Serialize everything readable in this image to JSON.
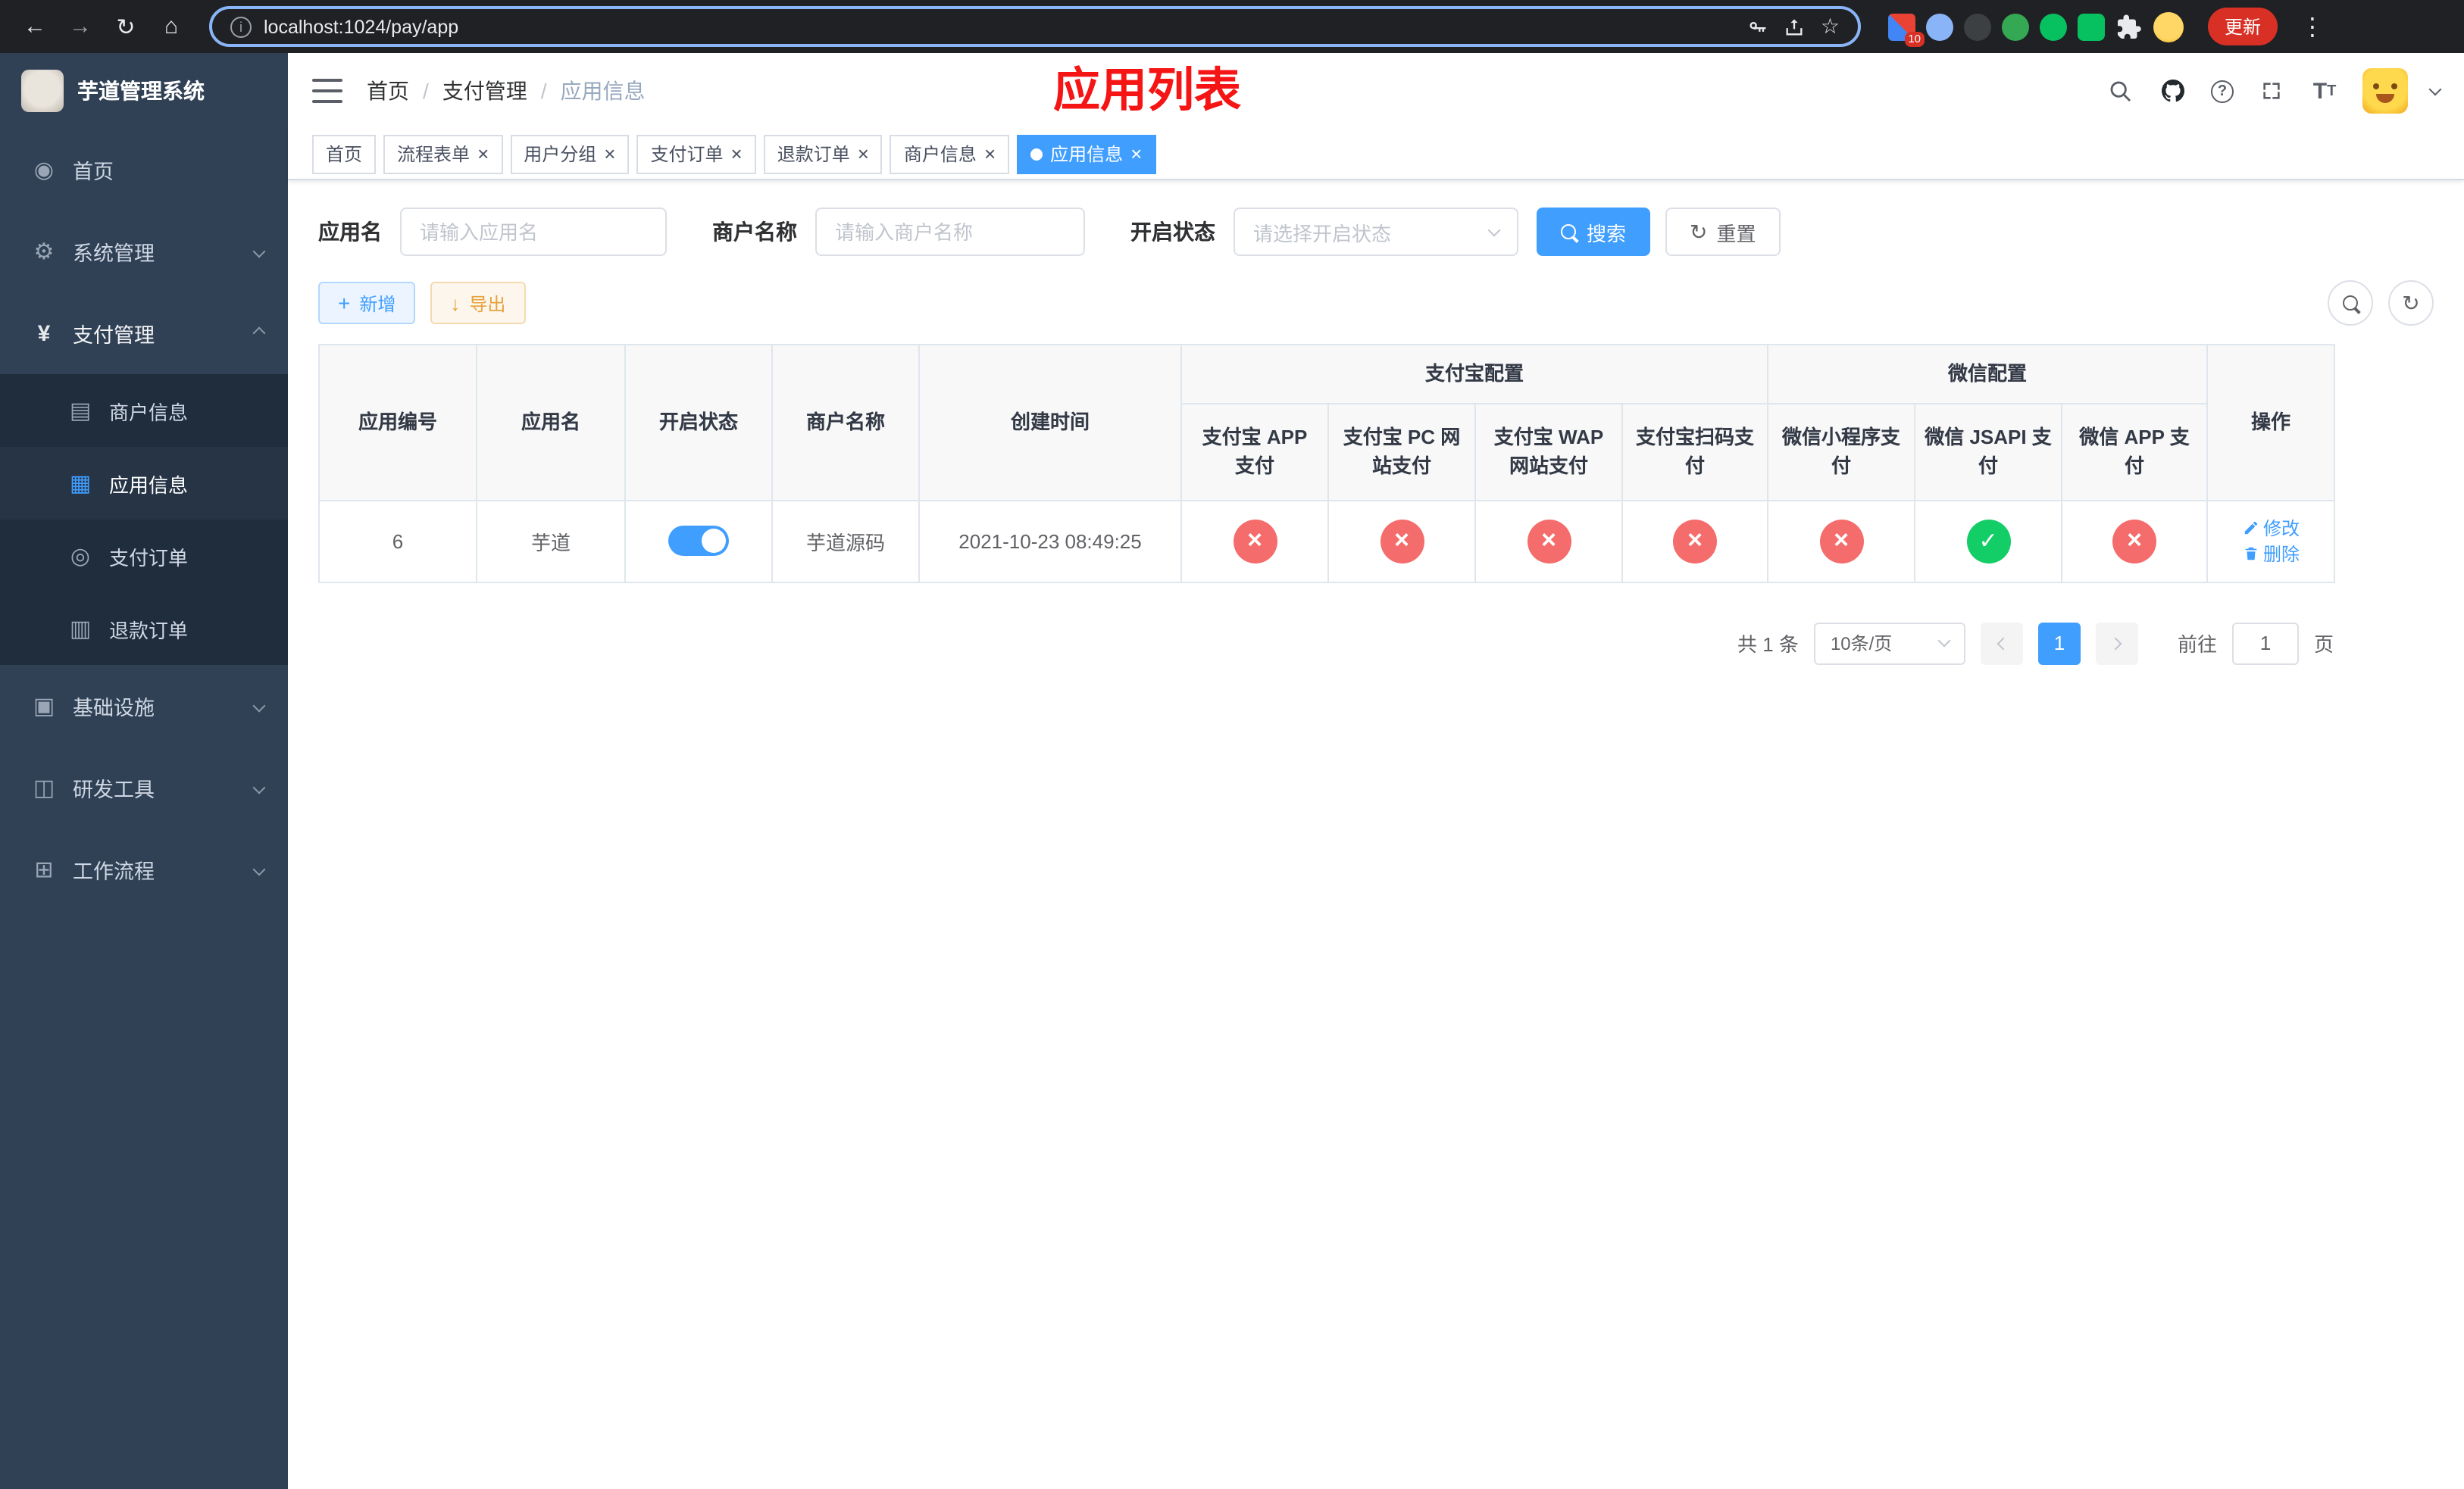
{
  "browser": {
    "url": "localhost:1024/pay/app",
    "update_label": "更新",
    "extension_badge": "10"
  },
  "sidebar": {
    "title": "芋道管理系统",
    "menu": [
      "首页",
      "系统管理",
      "支付管理",
      "商户信息",
      "应用信息",
      "支付订单",
      "退款订单",
      "基础设施",
      "研发工具",
      "工作流程"
    ]
  },
  "header": {
    "breadcrumb": [
      "首页",
      "支付管理",
      "应用信息"
    ],
    "annotation": "应用列表"
  },
  "tabs": [
    "首页",
    "流程表单",
    "用户分组",
    "支付订单",
    "退款订单",
    "商户信息",
    "应用信息"
  ],
  "filters": {
    "app_name_label": "应用名",
    "app_name_placeholder": "请输入应用名",
    "merchant_label": "商户名称",
    "merchant_placeholder": "请输入商户名称",
    "status_label": "开启状态",
    "status_placeholder": "请选择开启状态",
    "search_label": "搜索",
    "reset_label": "重置"
  },
  "toolbar": {
    "add_label": "新增",
    "export_label": "导出"
  },
  "table": {
    "main_columns": [
      "应用编号",
      "应用名",
      "开启状态",
      "商户名称",
      "创建时间"
    ],
    "group_alipay": "支付宝配置",
    "group_wechat": "微信配置",
    "alipay_columns": [
      "支付宝 APP 支付",
      "支付宝 PC 网站支付",
      "支付宝 WAP 网站支付",
      "支付宝扫码支付"
    ],
    "wechat_columns": [
      "微信小程序支付",
      "微信 JSAPI 支付",
      "微信 APP 支付"
    ],
    "ops_column": "操作",
    "row": {
      "id": "6",
      "name": "芋道",
      "enabled": true,
      "merchant": "芋道源码",
      "created_at": "2021-10-23 08:49:25",
      "alipay_app": false,
      "alipay_pc": false,
      "alipay_wap": false,
      "alipay_qr": false,
      "wx_mini": false,
      "wx_jsapi": true,
      "wx_app": false,
      "edit_label": "修改",
      "delete_label": "删除"
    }
  },
  "pagination": {
    "total": "共 1 条",
    "page_size": "10条/页",
    "page": "1",
    "goto_label": "前往",
    "goto_value": "1",
    "unit_label": "页"
  }
}
